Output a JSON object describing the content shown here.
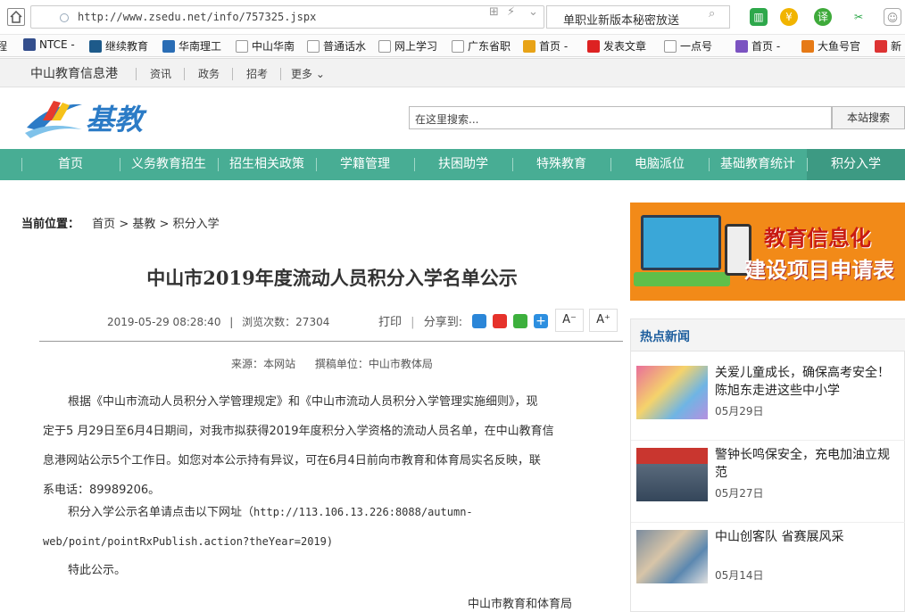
{
  "browser": {
    "url": "http://www.zsedu.net/info/757325.jspx",
    "search_text": "单职业新版本秘密放送",
    "bookmarks": [
      "程",
      "NTCE -",
      "继续教育",
      "华南理工",
      "中山华南",
      "普通话水",
      "网上学习",
      "广东省职",
      "首页 -",
      "发表文章",
      "一点号",
      "首页 -",
      "大鱼号官",
      "新"
    ]
  },
  "topnav": {
    "brand": "中山教育信息港",
    "links": [
      "资讯",
      "政务",
      "招考",
      "更多"
    ]
  },
  "header": {
    "logo_text": "基教",
    "search_placeholder": "在这里搜索...",
    "search_button": "本站搜索"
  },
  "mainnav": {
    "items": [
      "首页",
      "义务教育招生",
      "招生相关政策",
      "学籍管理",
      "扶困助学",
      "特殊教育",
      "电脑派位",
      "基础教育统计",
      "积分入学"
    ],
    "active_index": 8,
    "color": "#48ad94"
  },
  "breadcrumb": {
    "label": "当前位置：",
    "items": [
      "首页",
      ">",
      "基教",
      ">",
      "积分入学"
    ]
  },
  "article": {
    "title": "中山市2019年度流动人员积分入学名单公示",
    "date": "2019-05-29 08:28:40",
    "views_label": "浏览次数：",
    "views": "27304",
    "print_label": "打印",
    "share_label": "分享到:",
    "font_small": "A⁻",
    "font_large": "A⁺",
    "source_label": "来源：",
    "source": "本网站",
    "author_label": "撰稿单位：",
    "author": "中山市教体局",
    "p1_line1": "根据《中山市流动人员积分入学管理规定》和《中山市流动人员积分入学管理实施细则》，现",
    "p1_line2": "定于5 月29日至6月4日期间，对我市拟获得2019年度积分入学资格的流动人员名单，在中山教育信",
    "p1_line3": "息港网站公示5个工作日。如您对本公示持有异议，可在6月4日前向市教育和体育局实名反映，联",
    "p1_line4": "系电话：89989206。",
    "p2_line1_text": "积分入学公示名单请点击以下网址（",
    "p2_line1_url": "http://113.106.13.226:8088/autumn-",
    "p2_line2": "web/point/pointRxPublish.action?theYear=2019)",
    "p3": "特此公示。",
    "sign": "中山市教育和体育局"
  },
  "banner": {
    "line1": "教育信息化",
    "line2": "建设项目申请表"
  },
  "hot_news": {
    "title": "热点新闻",
    "items": [
      {
        "title": "关爱儿童成长，确保高考安全！陈旭东走进这些中小学",
        "date": "05月29日"
      },
      {
        "title": "警钟长鸣保安全，充电加油立规范",
        "date": "05月27日"
      },
      {
        "title": "中山创客队 省赛展风采",
        "date": "05月14日"
      }
    ]
  }
}
